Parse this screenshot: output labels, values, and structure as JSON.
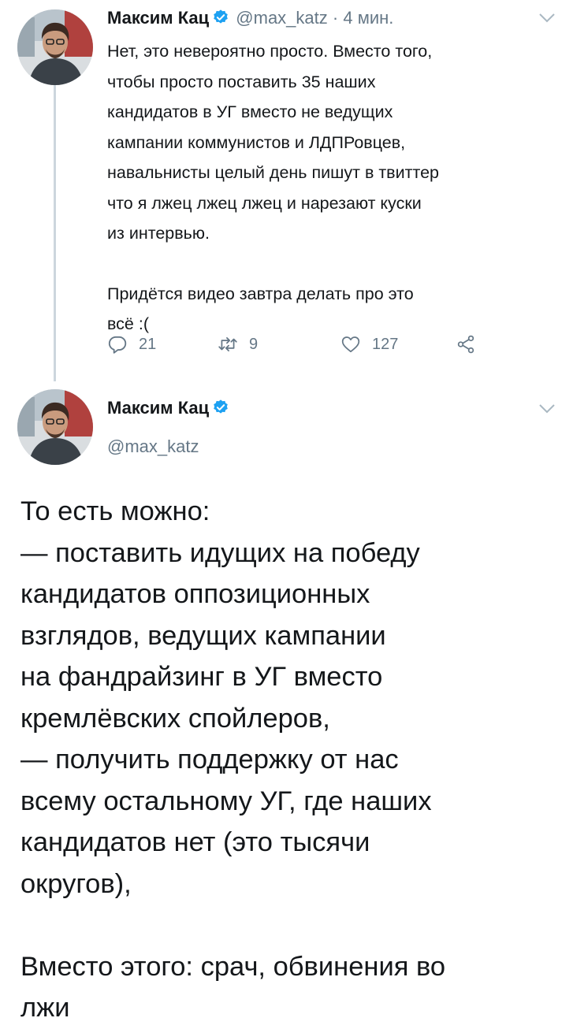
{
  "tweet1": {
    "author_name": "Максим Кац",
    "handle": "@max_katz",
    "separator": "·",
    "time": "4 мин.",
    "text_lines_p1": [
      "Нет, это невероятно просто. Вместо того,",
      "чтобы просто поставить 35 наших",
      "кандидатов в УГ вместо не ведущих",
      "кампании коммунистов и ЛДПРовцев,",
      "навальнисты целый день пишут в твиттер",
      "что я лжец лжец лжец и нарезают куски",
      "из интервью."
    ],
    "text_lines_p2": [
      "Придётся видео завтра делать про это",
      "всё :("
    ],
    "actions": {
      "reply_icon": "reply-icon",
      "reply_count": "21",
      "retweet_icon": "retweet-icon",
      "retweet_count": "9",
      "like_icon": "like-icon",
      "like_count": "127",
      "share_icon": "share-icon"
    }
  },
  "tweet2": {
    "author_name": "Максим Кац",
    "handle": "@max_katz",
    "text_lines": [
      "То есть можно:",
      "— поставить идущих на победу",
      "кандидатов оппозиционных",
      "взглядов, ведущих кампании",
      "на фандрайзинг в УГ вместо",
      "кремлёвских спойлеров,",
      "— получить поддержку от нас",
      "всему остальному УГ, где наших",
      "кандидатов нет (это тысячи",
      "округов),",
      "",
      "Вместо этого: срач, обвинения во",
      "лжи"
    ]
  },
  "colors": {
    "text": "#14171a",
    "secondary": "#657786",
    "verified_badge": "#1da1f2",
    "thread_line": "#ccd6dd"
  }
}
